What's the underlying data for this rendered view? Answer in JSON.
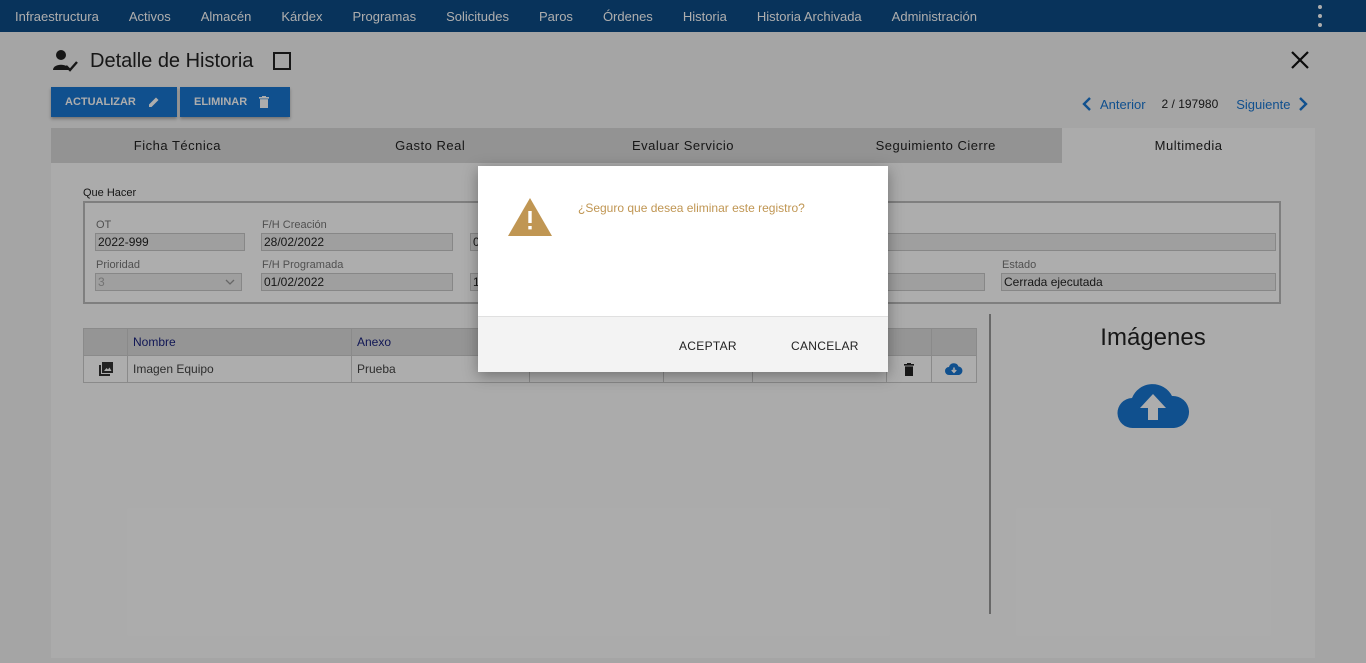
{
  "nav": {
    "items": [
      "Infraestructura",
      "Activos",
      "Almacén",
      "Kárdex",
      "Programas",
      "Solicitudes",
      "Paros",
      "Órdenes",
      "Historia",
      "Historia Archivada",
      "Administración"
    ]
  },
  "page": {
    "title": "Detalle de Historia"
  },
  "toolbar": {
    "update_label": "ACTUALIZAR",
    "delete_label": "ELIMINAR"
  },
  "pager": {
    "prev_label": "Anterior",
    "counter": "2 / 197980",
    "next_label": "Siguiente"
  },
  "tabs": [
    {
      "label": "Ficha Técnica",
      "active": false
    },
    {
      "label": "Gasto Real",
      "active": false
    },
    {
      "label": "Evaluar Servicio",
      "active": false
    },
    {
      "label": "Seguimiento Cierre",
      "active": false
    },
    {
      "label": "Multimedia",
      "active": true
    }
  ],
  "form": {
    "legend": "Que Hacer",
    "ot_label": "OT",
    "ot_value": "2022-999",
    "created_label": "F/H Creación",
    "created_value": "28/02/2022",
    "col3_row1_partial": "0",
    "priority_label": "Prioridad",
    "priority_value": "3",
    "scheduled_label": "F/H Programada",
    "scheduled_value": "01/02/2022",
    "col3_row2_partial": "1",
    "status_label": "Estado",
    "status_value": "Cerrada ejecutada"
  },
  "table": {
    "headers": [
      "Nombre",
      "Anexo"
    ],
    "rows": [
      {
        "nombre": "Imagen Equipo",
        "anexo": "Prueba"
      }
    ]
  },
  "images": {
    "title": "Imágenes"
  },
  "dialog": {
    "message": "¿Seguro que desea eliminar este registro?",
    "accept_label": "ACEPTAR",
    "cancel_label": "CANCELAR"
  },
  "colors": {
    "nav_bg": "#0d4c87",
    "primary": "#1976d2",
    "warning": "#c09653"
  }
}
